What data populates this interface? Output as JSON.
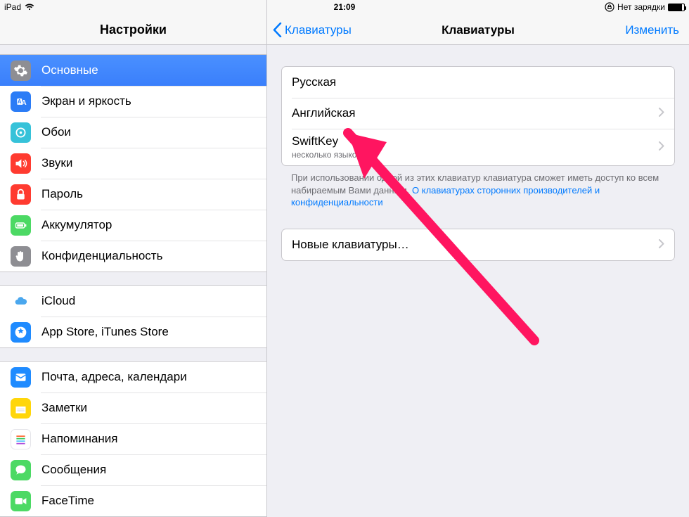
{
  "status": {
    "device": "iPad",
    "time": "21:09",
    "charging_text": "Нет зарядки"
  },
  "sidebar": {
    "title": "Настройки",
    "groups": [
      {
        "items": [
          {
            "key": "general",
            "label": "Основные",
            "selected": true
          },
          {
            "key": "display",
            "label": "Экран и яркость"
          },
          {
            "key": "wallpaper",
            "label": "Обои"
          },
          {
            "key": "sounds",
            "label": "Звуки"
          },
          {
            "key": "passcode",
            "label": "Пароль"
          },
          {
            "key": "battery",
            "label": "Аккумулятор"
          },
          {
            "key": "privacy",
            "label": "Конфиденциальность"
          }
        ]
      },
      {
        "items": [
          {
            "key": "icloud",
            "label": "iCloud"
          },
          {
            "key": "appstore",
            "label": "App Store, iTunes Store"
          }
        ]
      },
      {
        "items": [
          {
            "key": "mail",
            "label": "Почта, адреса, календари"
          },
          {
            "key": "notes",
            "label": "Заметки"
          },
          {
            "key": "reminders",
            "label": "Напоминания"
          },
          {
            "key": "messages",
            "label": "Сообщения"
          },
          {
            "key": "facetime",
            "label": "FaceTime"
          }
        ]
      }
    ]
  },
  "detail": {
    "back_label": "Клавиатуры",
    "title": "Клавиатуры",
    "edit_label": "Изменить",
    "keyboards": [
      {
        "label": "Русская",
        "disclosure": false
      },
      {
        "label": "Английская",
        "disclosure": true
      },
      {
        "label": "SwiftKey",
        "sub": "несколько языков",
        "disclosure": true
      }
    ],
    "footer_pre": "При использовании одной из этих клавиатур клавиатура сможет иметь доступ ко всем набираемым Вами данным. ",
    "footer_link": "О клавиатурах сторонних производителей и конфиденциальности",
    "new_keyboards_label": "Новые клавиатуры…"
  }
}
